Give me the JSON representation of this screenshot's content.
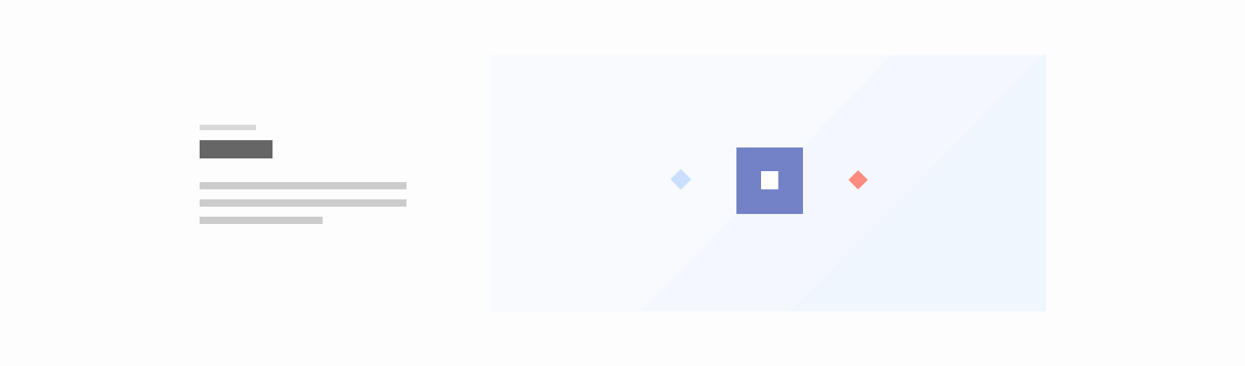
{
  "illustration": {
    "colors": {
      "page_background": "#fdfdfd",
      "panel_background": "#f8fafe",
      "panel_band_light": "#f4f8fe",
      "panel_band_lighter": "#eff6fe",
      "feature_box": "#7382c6",
      "feature_box_inner": "#ffffff",
      "diamond_left": "#c8e0fb",
      "diamond_right": "#fd8b7f"
    },
    "shapes": [
      "diamond",
      "square",
      "diamond"
    ]
  },
  "skeleton": {
    "colors": {
      "eyebrow": "#d9d9d9",
      "title": "#666666",
      "body_lines": "#cccccc"
    },
    "body_line_count": 3
  }
}
